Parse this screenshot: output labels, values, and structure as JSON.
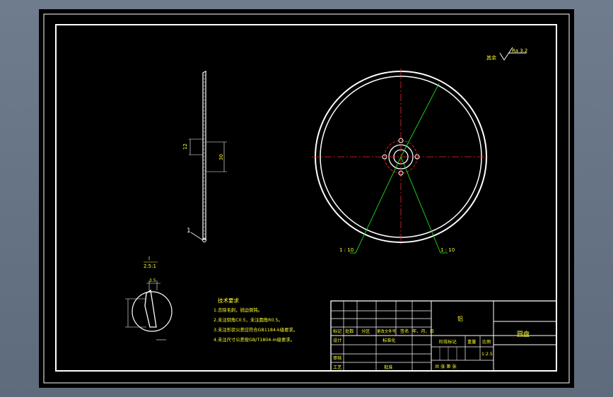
{
  "drawing": {
    "background": "#000000",
    "frame_color": "#ffffff",
    "line_color": "#ffffff",
    "center_line_color": "#ff2222",
    "leader_color": "#22dd22",
    "text_color": "#ffff33"
  },
  "roughness": {
    "prefix": "其余",
    "value": "Ra 3.2"
  },
  "side_view": {
    "part_label": "1",
    "dim_small": "12",
    "dim_large": "30"
  },
  "section_leaders": {
    "left": "1 : 10",
    "right": "1 : 10"
  },
  "detail_view": {
    "label": "I",
    "scale": "2.5:1",
    "dim": "3.5"
  },
  "tech_requirements": {
    "title": "技术要求",
    "items": [
      "1.去除毛刺，锐边倒钝。",
      "2.未注倒角C0.5，未注圆角R0.5。",
      "3.未注形状公差应符合GB1184-k级要求。",
      "4.未注尺寸公差按GB/T1804-m级要求。"
    ]
  },
  "title_block": {
    "material": "铝",
    "part_name": "圆盘",
    "header_row": [
      "标记",
      "处数",
      "分区",
      "更改文件号",
      "签名",
      "年、月、日"
    ],
    "left_labels": [
      "设计",
      "审核",
      "工艺"
    ],
    "mid_labels": [
      "标准化",
      "批准"
    ],
    "stage_label": "阶段标记",
    "weight_label": "重量",
    "scale_label": "比例",
    "scale_value": "1:2.5",
    "sheet_text": "共  张  第  张"
  }
}
